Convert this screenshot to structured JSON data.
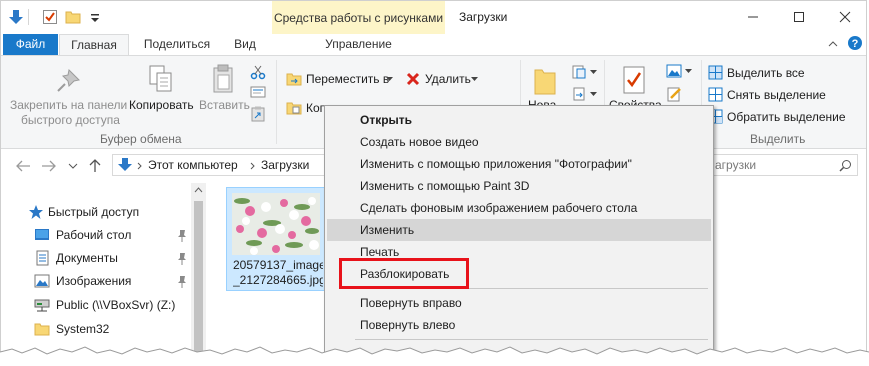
{
  "window": {
    "title": "Загрузки",
    "contextual_header": "Средства работы с рисунками"
  },
  "tabs": {
    "file": "Файл",
    "home": "Главная",
    "share": "Поделиться",
    "view": "Вид",
    "manage": "Управление"
  },
  "ribbon": {
    "pin_line1": "Закрепить на панели",
    "pin_line2": "быстрого доступа",
    "copy": "Копировать",
    "paste": "Вставить",
    "clipboard_group": "Буфер обмена",
    "move_to": "Переместить в",
    "copy_to": "Копи",
    "delete": "Удалить",
    "new_folder": "Нова",
    "properties": "Свойства",
    "select_all": "Выделить все",
    "select_none": "Снять выделение",
    "invert_selection": "Обратить выделение",
    "select_group": "Выделить"
  },
  "address": {
    "crumbs": [
      "Этот компьютер",
      "Загрузки"
    ],
    "search_placeholder": "агрузки"
  },
  "nav": {
    "quick_access": "Быстрый доступ",
    "items": [
      {
        "label": "Рабочий стол",
        "pinned": true
      },
      {
        "label": "Документы",
        "pinned": true
      },
      {
        "label": "Изображения",
        "pinned": true
      },
      {
        "label": "Public (\\\\VBoxSvr) (Z:)",
        "pinned": false
      },
      {
        "label": "System32",
        "pinned": false
      }
    ]
  },
  "file": {
    "name_line1": "20579137_images",
    "name_line2": "_2127284665.jpg"
  },
  "context_menu": {
    "items": [
      "Открыть",
      "Создать новое видео",
      "Изменить с помощью приложения \"Фотографии\"",
      "Изменить с помощью Paint 3D",
      "Сделать фоновым изображением рабочего стола",
      "Изменить",
      "Печать",
      "Разблокировать",
      "Повернуть вправо",
      "Повернуть влево"
    ],
    "default_item": "Открыть",
    "hovered_item": "Изменить",
    "highlighted_item": "Разблокировать"
  },
  "colors": {
    "accent": "#1979ca",
    "tools_header": "#fdf5c8",
    "selection": "#cce8ff",
    "menu_hover": "#d6d6d6",
    "callout": "#e8121a"
  }
}
